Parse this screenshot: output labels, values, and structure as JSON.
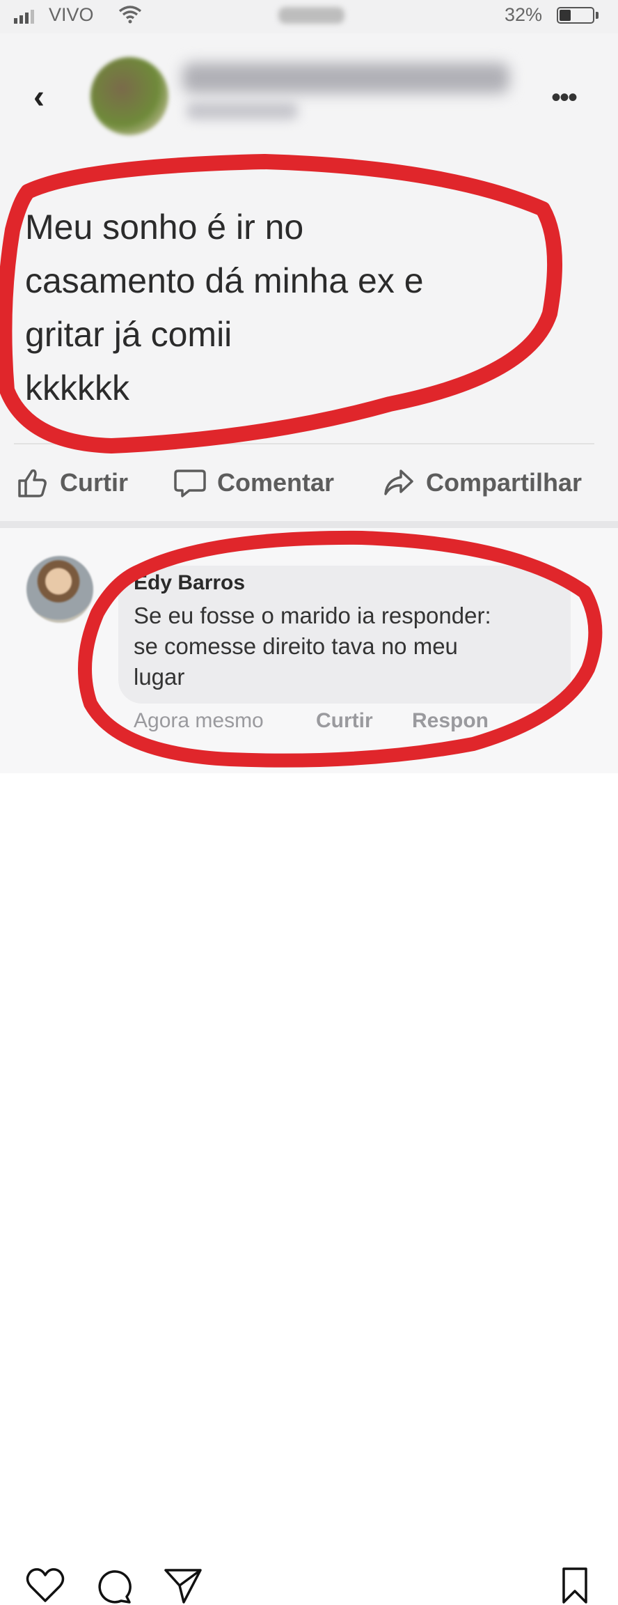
{
  "status_bar": {
    "carrier": "VIVO",
    "battery": "32%",
    "icons": [
      "signal-icon",
      "wifi-icon",
      "battery-icon"
    ]
  },
  "post": {
    "text_lines": [
      "Meu sonho é ir no",
      "casamento dá minha ex e",
      "gritar já comii",
      "kkkkkk"
    ],
    "icons": [
      "back-icon",
      "more-icon"
    ]
  },
  "actions": {
    "like": "Curtir",
    "comment": "Comentar",
    "share": "Compartilhar"
  },
  "comment": {
    "author": "Edy Barros",
    "text_lines": [
      "Se eu fosse o marido ia responder:",
      "se comesse direito tava no meu",
      "lugar"
    ],
    "time": "Agora mesmo",
    "like": "Curtir",
    "reply": "Respon"
  },
  "instagram_bar": {
    "icons": [
      "heart-icon",
      "comment-icon",
      "share-icon",
      "bookmark-icon"
    ]
  },
  "colors": {
    "highlight_circle": "#e0262b",
    "action_text": "#5c5c5c"
  }
}
